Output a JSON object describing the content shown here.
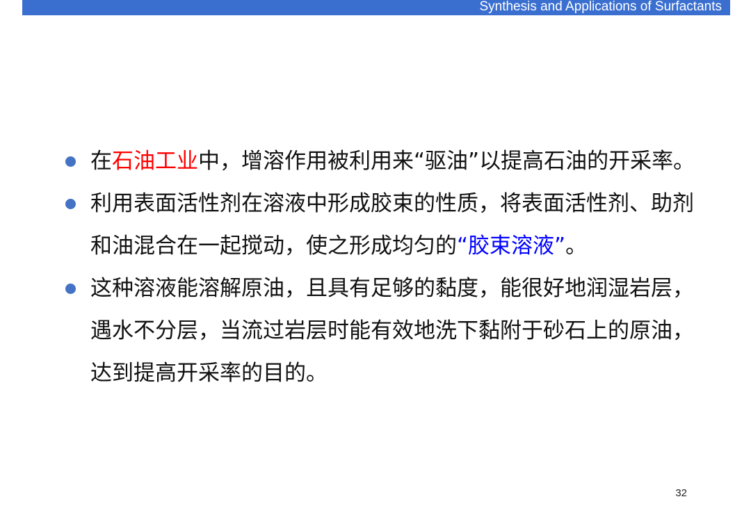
{
  "header": {
    "title": "Synthesis and Applications of Surfactants",
    "bar_color": "#3a6fd0"
  },
  "bullets": [
    {
      "before": "在",
      "highlight": "石油工业",
      "after": "中，增溶作用被利用来“驱油”以提高石油的开采率。",
      "highlight_color": "#ff0000"
    },
    {
      "before": "利用表面活性剂在溶液中形成胶束的性质，将表面活性剂、助剂和油混合在一起搅动，使之形成均匀的",
      "highlight": "“胶束溶液”",
      "after": "。",
      "highlight_color": "#0000ff"
    },
    {
      "text": "这种溶液能溶解原油，且具有足够的黏度，能很好地润湿岩层，遇水不分层，当流过岩层时能有效地洗下黏附于砂石上的原油，达到提高开采率的目的。"
    }
  ],
  "bullet_color": "#4472c4",
  "page_number": "32"
}
